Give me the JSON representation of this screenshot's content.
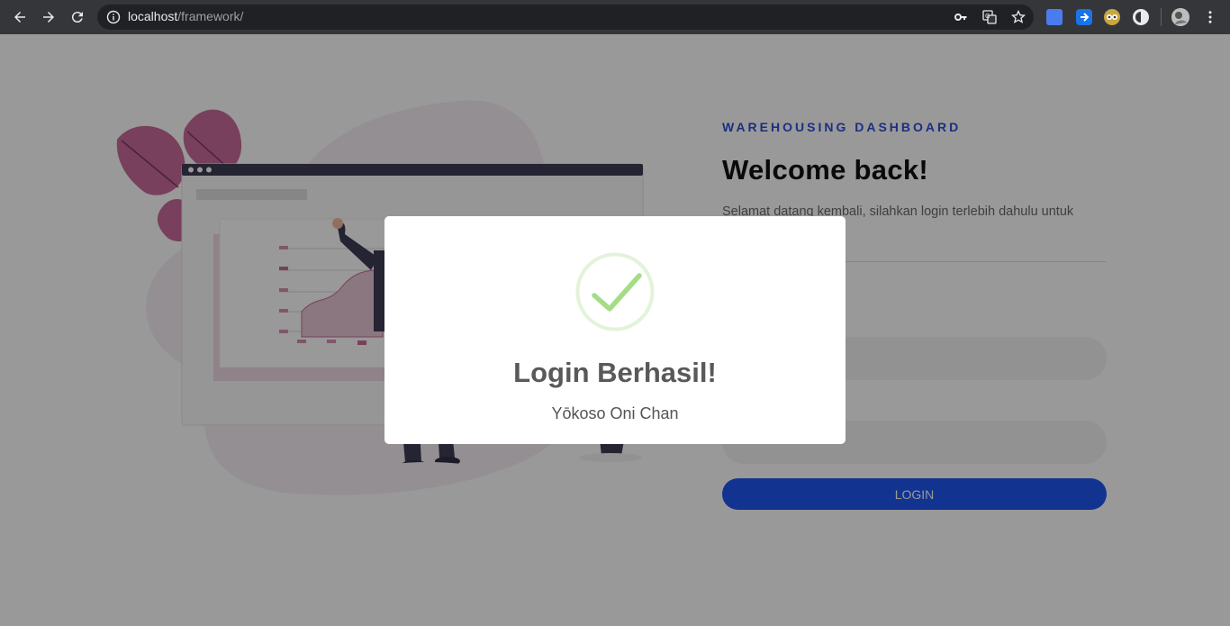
{
  "browser": {
    "url_host": "localhost",
    "url_path": "/framework/",
    "icons": [
      "back-icon",
      "forward-icon",
      "reload-icon",
      "info-icon",
      "key-icon",
      "translate-icon",
      "star-icon",
      "extension-icons",
      "profile-avatar",
      "menu-icon"
    ]
  },
  "page": {
    "eyebrow": "WAREHOUSING DASHBOARD",
    "welcome": "Welcome back!",
    "description": "Selamat datang kembali, silahkan login terlebih dahulu untuk memasuki system",
    "username_placeholder": "",
    "password_placeholder": "",
    "login_label": "LOGIN"
  },
  "modal": {
    "title": "Login Berhasil!",
    "message": "Yōkoso Oni Chan",
    "icon": "success-check-icon"
  },
  "colors": {
    "accent": "#2d4fd6",
    "button": "#1f55f0",
    "success": "#a5dc86",
    "success_ring": "rgba(165,220,134,0.3)"
  }
}
